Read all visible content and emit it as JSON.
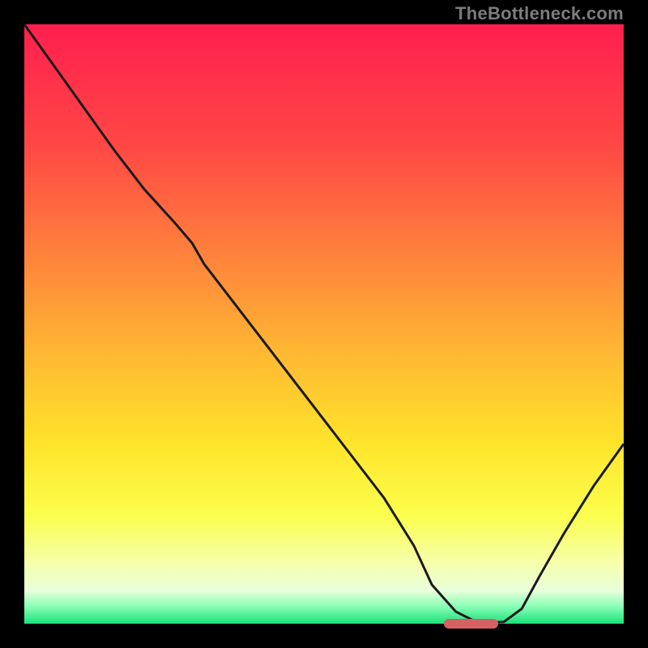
{
  "watermark": "TheBottleneck.com",
  "colors": {
    "bg_black": "#000000",
    "gradient_stops": [
      {
        "offset": 0.0,
        "color": "#ff1f4e"
      },
      {
        "offset": 0.2,
        "color": "#ff4745"
      },
      {
        "offset": 0.4,
        "color": "#ff873b"
      },
      {
        "offset": 0.55,
        "color": "#ffb833"
      },
      {
        "offset": 0.7,
        "color": "#ffe42b"
      },
      {
        "offset": 0.82,
        "color": "#fbff4d"
      },
      {
        "offset": 0.9,
        "color": "#f6ffad"
      },
      {
        "offset": 0.945,
        "color": "#e9ffdb"
      },
      {
        "offset": 0.97,
        "color": "#8effb8"
      },
      {
        "offset": 1.0,
        "color": "#18e27a"
      }
    ],
    "curve_stroke": "#1a1a1a",
    "marker_fill": "#d66165"
  },
  "chart_data": {
    "type": "line",
    "title": "",
    "xlabel": "",
    "ylabel": "",
    "xlim": [
      0,
      100
    ],
    "ylim": [
      0,
      100
    ],
    "x": [
      0,
      5,
      10,
      15,
      20,
      25,
      28,
      30,
      35,
      40,
      45,
      50,
      55,
      60,
      65,
      68,
      72,
      75,
      78,
      80,
      83,
      86,
      90,
      95,
      100
    ],
    "values": [
      100,
      93,
      86,
      79,
      72.5,
      67,
      63.5,
      60,
      53.5,
      47,
      40.5,
      34,
      27.5,
      21,
      13,
      6.5,
      2,
      0.5,
      0.2,
      0.3,
      2.5,
      8,
      15,
      23,
      30
    ],
    "marker": {
      "x_start": 70,
      "x_end": 79,
      "y": 0
    }
  }
}
